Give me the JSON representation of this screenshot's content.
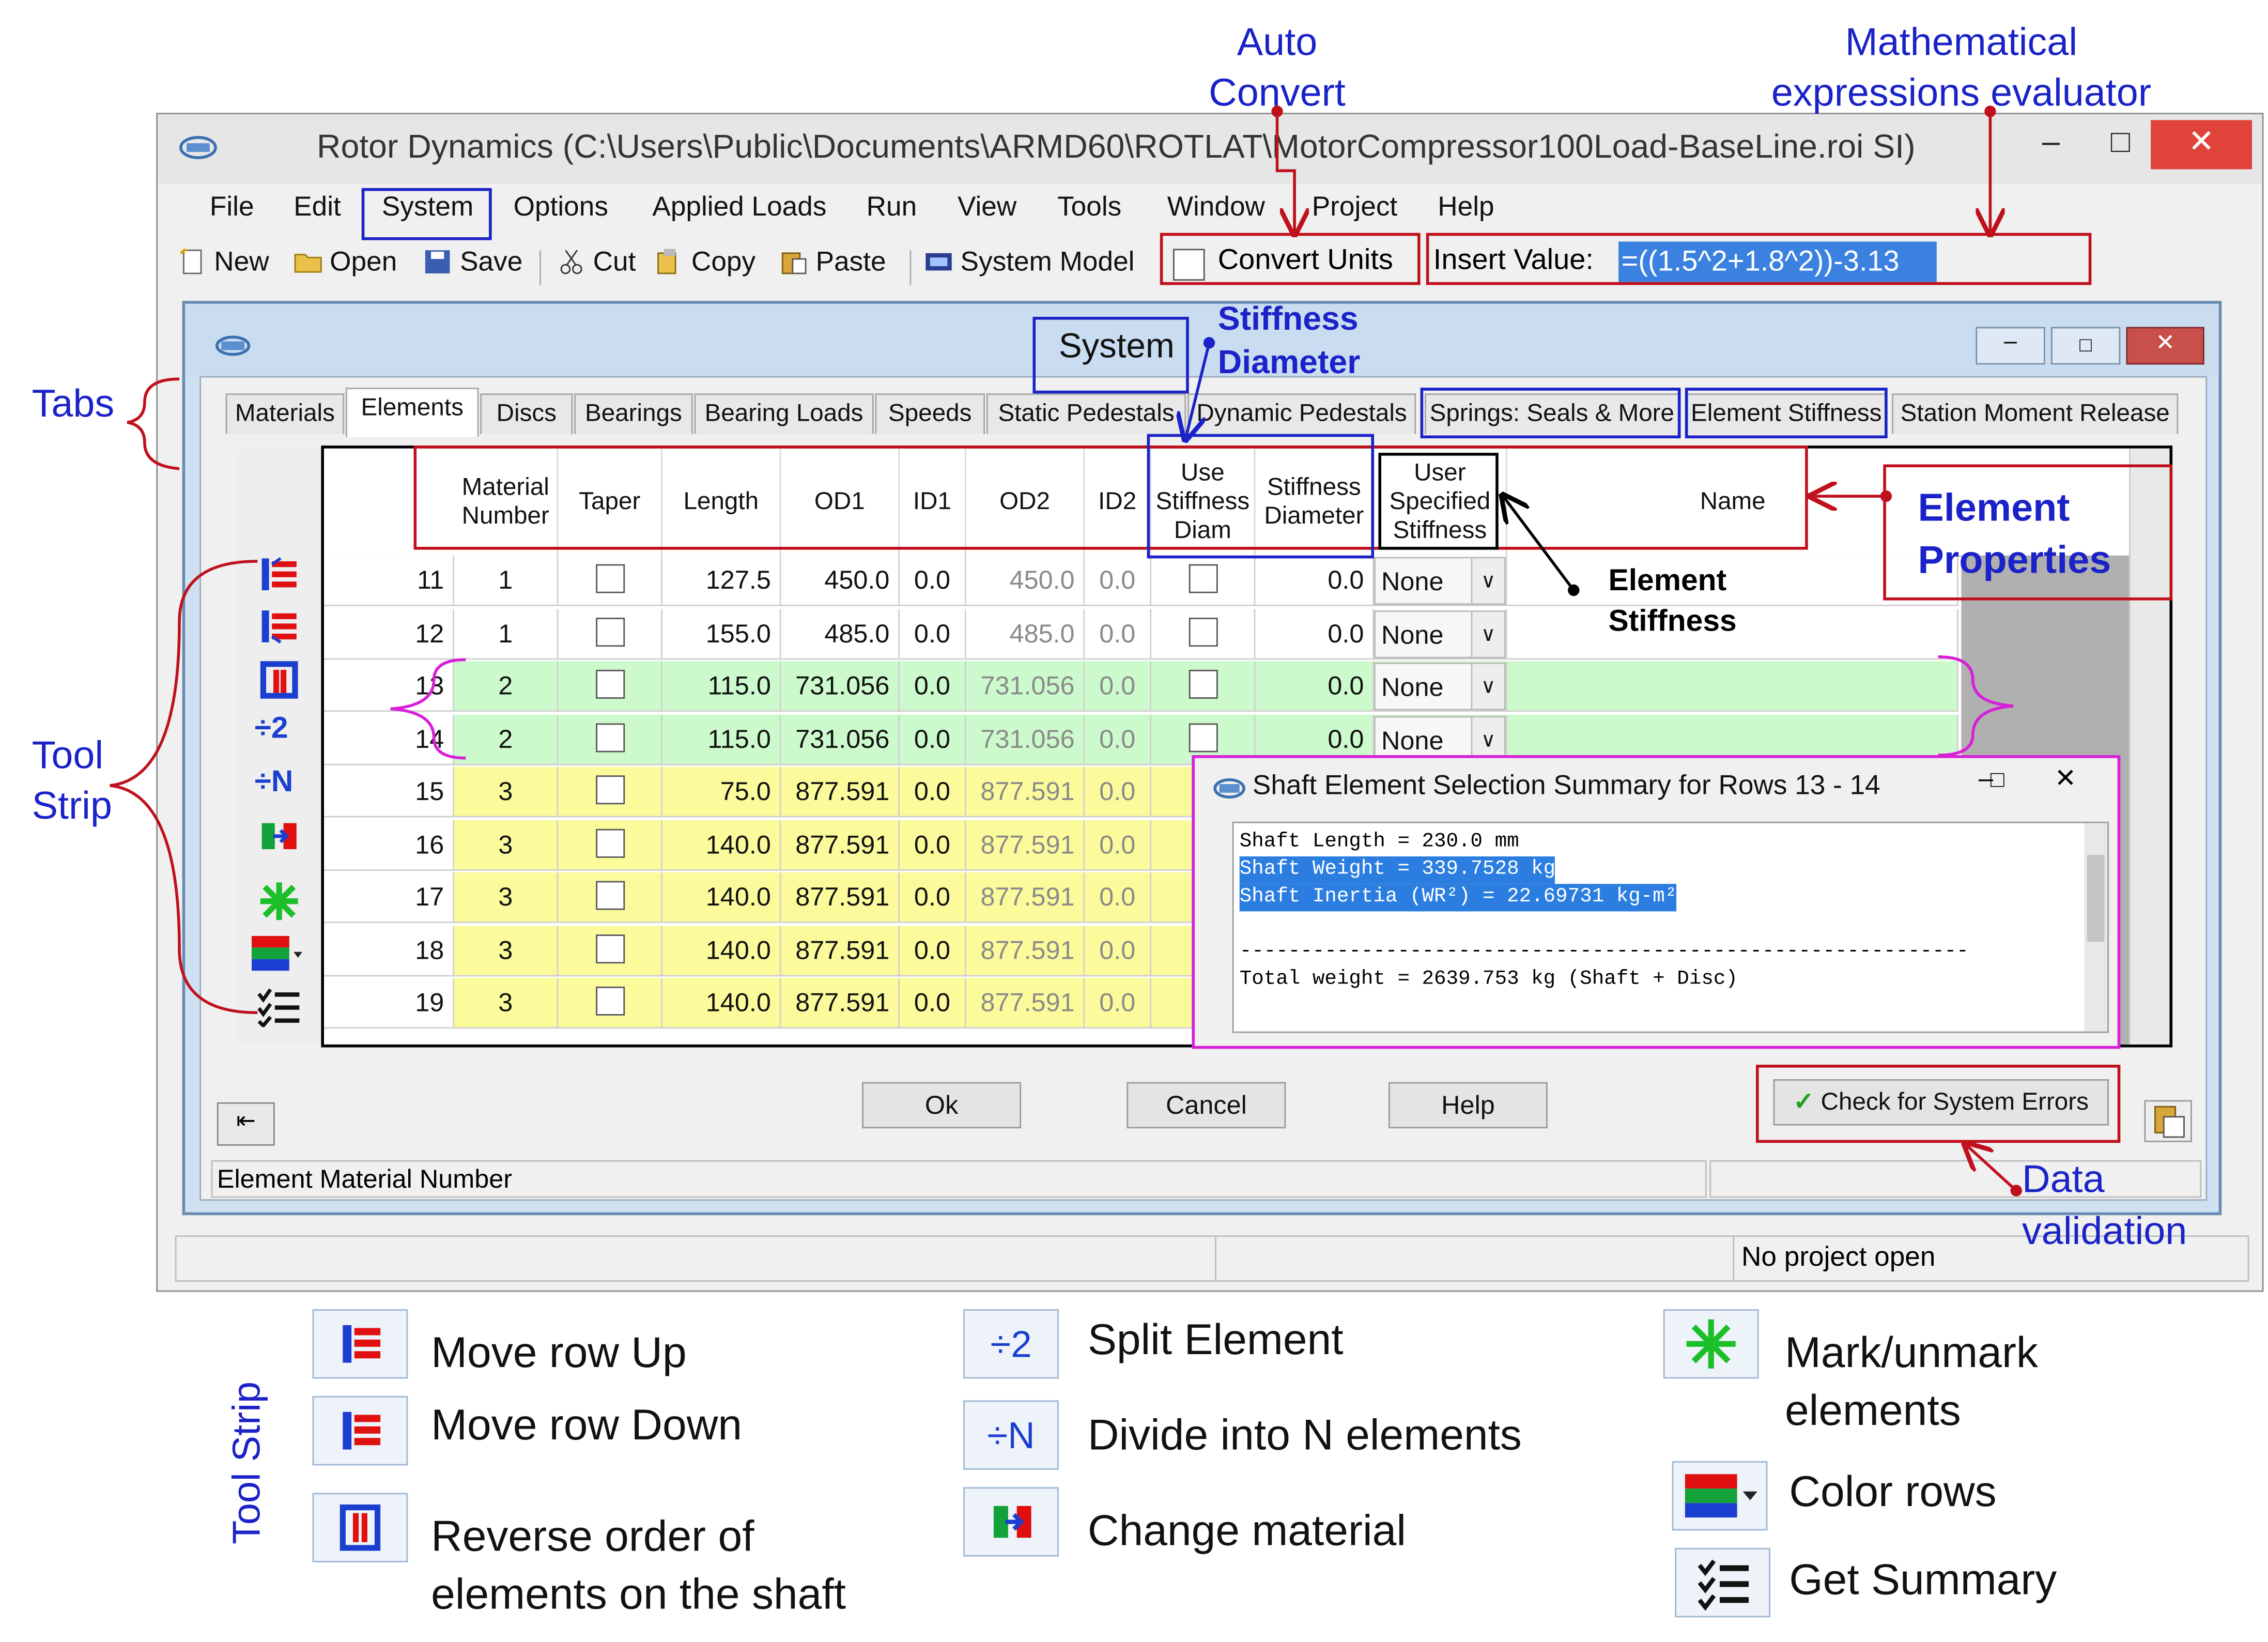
{
  "annotations": {
    "auto_convert": [
      "Auto",
      "Convert"
    ],
    "math_eval": [
      "Mathematical",
      "expressions evaluator"
    ],
    "tabs": "Tabs",
    "tool_strip": [
      "Tool",
      "Strip"
    ],
    "stiffness_diameter": [
      "Stiffness",
      "Diameter"
    ],
    "element_properties": [
      "Element",
      "Properties"
    ],
    "element_stiffness": [
      "Element",
      "Stiffness"
    ],
    "data_validation": [
      "Data",
      "validation"
    ],
    "legend_vertical": "Tool Strip"
  },
  "main_window": {
    "title": "Rotor Dynamics (C:\\Users\\Public\\Documents\\ARMD60\\ROTLAT\\MotorCompressor100Load-BaseLine.roi SI)",
    "menu": [
      "File",
      "Edit",
      "System",
      "Options",
      "Applied Loads",
      "Run",
      "View",
      "Tools",
      "Window",
      "Project",
      "Help"
    ],
    "toolbar": {
      "new": "New",
      "open": "Open",
      "save": "Save",
      "cut": "Cut",
      "copy": "Copy",
      "paste": "Paste",
      "system_model": "System Model",
      "convert_units": "Convert Units",
      "insert_value_label": "Insert Value:",
      "insert_value": "=((1.5^2+1.8^2))-3.13"
    },
    "status": {
      "project": "No project open"
    }
  },
  "system_window": {
    "title": "System",
    "tabs": [
      "Materials",
      "Elements",
      "Discs",
      "Bearings",
      "Bearing Loads",
      "Speeds",
      "Static Pedestals",
      "Dynamic Pedestals",
      "Springs: Seals & More",
      "Element Stiffness",
      "Station Moment Release"
    ],
    "columns": {
      "material_number": [
        "Material",
        "Number"
      ],
      "taper": "Taper",
      "length": "Length",
      "od1": "OD1",
      "id1": "ID1",
      "od2": "OD2",
      "id2": "ID2",
      "use_stiffness_diam": [
        "Use",
        "Stiffness",
        "Diam"
      ],
      "stiffness_diameter": [
        "Stiffness",
        "Diameter"
      ],
      "user_specified_stiffness": [
        "User",
        "Specified",
        "Stiffness"
      ],
      "name": "Name"
    },
    "rows": [
      {
        "row": "11",
        "material": "1",
        "length": "127.5",
        "od1": "450.0",
        "id1": "0.0",
        "od2": "450.0",
        "id2": "0.0",
        "stiff_diam": "0.0",
        "user_stiff": "None",
        "color": "white"
      },
      {
        "row": "12",
        "material": "1",
        "length": "155.0",
        "od1": "485.0",
        "id1": "0.0",
        "od2": "485.0",
        "id2": "0.0",
        "stiff_diam": "0.0",
        "user_stiff": "None",
        "color": "white"
      },
      {
        "row": "13",
        "material": "2",
        "length": "115.0",
        "od1": "731.056",
        "id1": "0.0",
        "od2": "731.056",
        "id2": "0.0",
        "stiff_diam": "0.0",
        "user_stiff": "None",
        "color": "green"
      },
      {
        "row": "14",
        "material": "2",
        "length": "115.0",
        "od1": "731.056",
        "id1": "0.0",
        "od2": "731.056",
        "id2": "0.0",
        "stiff_diam": "0.0",
        "user_stiff": "None",
        "color": "green"
      },
      {
        "row": "15",
        "material": "3",
        "length": "75.0",
        "od1": "877.591",
        "id1": "0.0",
        "od2": "877.591",
        "id2": "0.0",
        "color": "yellow"
      },
      {
        "row": "16",
        "material": "3",
        "length": "140.0",
        "od1": "877.591",
        "id1": "0.0",
        "od2": "877.591",
        "id2": "0.0",
        "color": "yellow"
      },
      {
        "row": "17",
        "material": "3",
        "length": "140.0",
        "od1": "877.591",
        "id1": "0.0",
        "od2": "877.591",
        "id2": "0.0",
        "color": "yellow"
      },
      {
        "row": "18",
        "material": "3",
        "length": "140.0",
        "od1": "877.591",
        "id1": "0.0",
        "od2": "877.591",
        "id2": "0.0",
        "color": "yellow"
      },
      {
        "row": "19",
        "material": "3",
        "length": "140.0",
        "od1": "877.591",
        "id1": "0.0",
        "od2": "877.591",
        "id2": "0.0",
        "color": "yellow"
      }
    ],
    "buttons": {
      "ok": "Ok",
      "cancel": "Cancel",
      "help": "Help",
      "check_errors": "Check for System Errors"
    },
    "status_text": "Element Material Number"
  },
  "summary_popup": {
    "title": "Shaft Element Selection Summary for Rows 13 - 14",
    "lines": [
      "Shaft Length = 230.0 mm",
      "Shaft Weight = 339.7528 kg",
      "Shaft Inertia (WR²) = 22.69731 kg-m²",
      "",
      "------------------------------------------------------------",
      "Total weight = 2639.753 kg (Shaft + Disc)"
    ]
  },
  "legend": {
    "move_up": "Move row  Up",
    "move_down": "Move row  Down",
    "reverse": [
      "Reverse order of",
      "elements on the shaft"
    ],
    "split": "Split Element",
    "divide": "Divide into N elements",
    "change_material": "Change material",
    "mark": [
      "Mark/unmark",
      "elements"
    ],
    "color_rows": "Color rows",
    "get_summary": "Get Summary",
    "split_glyph": "÷2",
    "divide_glyph": "÷N"
  },
  "colors": {
    "annotation_blue": "#1a22c8",
    "annotation_red": "#c0101c",
    "row_green": "#ccfacc",
    "row_yellow": "#fbfb9c",
    "magenta": "#d81fd8"
  }
}
